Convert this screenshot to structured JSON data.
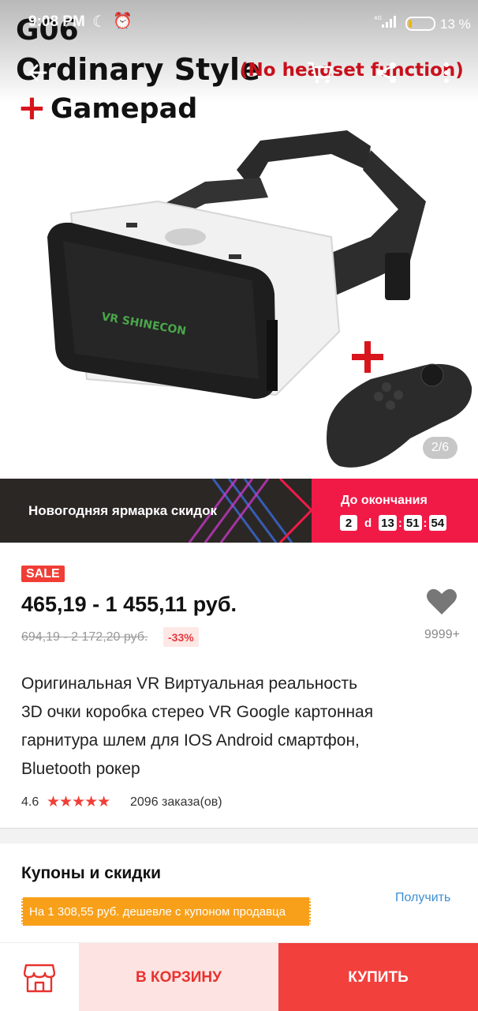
{
  "status_bar": {
    "time": "9:08 PM",
    "battery_percent": "13",
    "battery_level": 0.13,
    "network": "4G"
  },
  "hero": {
    "overlay": {
      "model": "G06",
      "style": "Ordinary Style",
      "note": "(No headset function)",
      "plus": "+",
      "gamepad": "Gamepad"
    },
    "product_logo": "VR SHINECON",
    "plus_gamepad": "+",
    "page_indicator": "2/6"
  },
  "promo": {
    "text": "Новогодняя ярмарка скидок",
    "ends_label": "До окончания",
    "timer": {
      "days": "2",
      "days_unit": "d",
      "hours": "13",
      "minutes": "51",
      "seconds": "54"
    }
  },
  "product": {
    "sale_badge": "SALE",
    "price": "465,19 - 1 455,11 руб.",
    "old_price": "694,19 - 2 172,20 руб.",
    "discount": "-33%",
    "favorites_count": "9999+",
    "title_lines": [
      "Оригинальная VR Виртуальная реальность",
      "3D очки коробка стерео VR Google картонная",
      "гарнитура шлем для IOS Android смартфон,",
      "Bluetooth рокер"
    ],
    "rating": "4.6",
    "rating_value": 4.6,
    "stars": "★★★★★",
    "orders": "2096 заказа(ов)"
  },
  "coupons": {
    "title": "Купоны и скидки",
    "get_label": "Получить",
    "tag": "На 1 308,55 руб. дешевле с купоном продавца"
  },
  "bottom_bar": {
    "store_icon": "store-icon",
    "cart_label": "В КОРЗИНУ",
    "buy_label": "КУПИТЬ"
  },
  "colors": {
    "accent": "#f2403d",
    "promo_bg": "#2b2725",
    "promo_red": "#f11a47",
    "coupon_orange": "#f8a01a",
    "link_blue": "#3d8ed6"
  }
}
